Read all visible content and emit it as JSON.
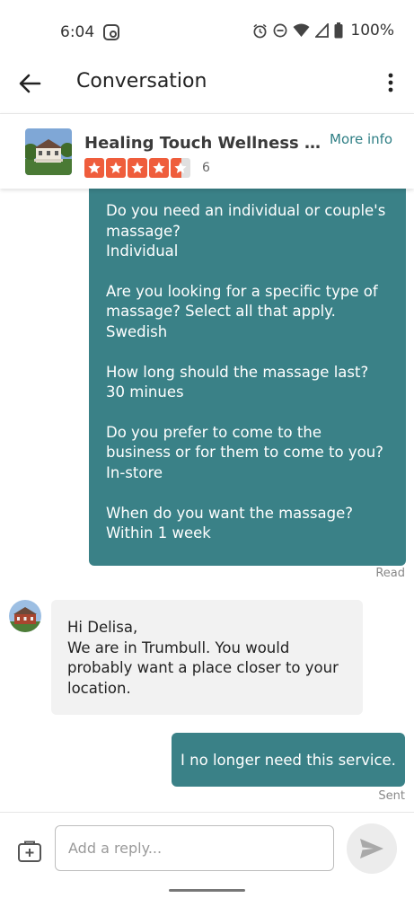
{
  "status_bar": {
    "time": "6:04",
    "battery": "100%",
    "icons": [
      "screen-record-icon",
      "alarm-icon",
      "dnd-icon",
      "wifi-icon",
      "signal-icon",
      "battery-icon"
    ]
  },
  "app_bar": {
    "title": "Conversation",
    "icons": [
      "back-arrow-icon",
      "more-vert-icon"
    ]
  },
  "business": {
    "name": "Healing Touch Wellness Ce...",
    "rating": 4.5,
    "rating_max": 5,
    "review_count": "6",
    "more_info": "More info",
    "star_color": "#ef5d3c"
  },
  "messages": {
    "sent_questionnaire": [
      {
        "question": "Do you need an individual or couple's massage?",
        "answer": "Individual"
      },
      {
        "question": "Are you looking for a specific type of massage? Select all that apply.",
        "answer": "Swedish"
      },
      {
        "question": "How long should the massage last?",
        "answer": "30 minues"
      },
      {
        "question": "Do you prefer to come to the business or for them to come to you?",
        "answer": "In-store"
      },
      {
        "question": "When do you want the massage?",
        "answer": "Within 1 week"
      }
    ],
    "read_receipt": "Read",
    "received": {
      "greeting": "Hi Delisa,",
      "body": "We are in Trumbull. You would probably want a place closer to your location."
    },
    "sent_short": "I no longer need this service.",
    "sent_receipt": "Sent"
  },
  "reply": {
    "placeholder": "Add a reply..."
  },
  "colors": {
    "accent": "#3a8187",
    "link": "#2f7f85",
    "received_bubble": "#f2f2f2"
  }
}
